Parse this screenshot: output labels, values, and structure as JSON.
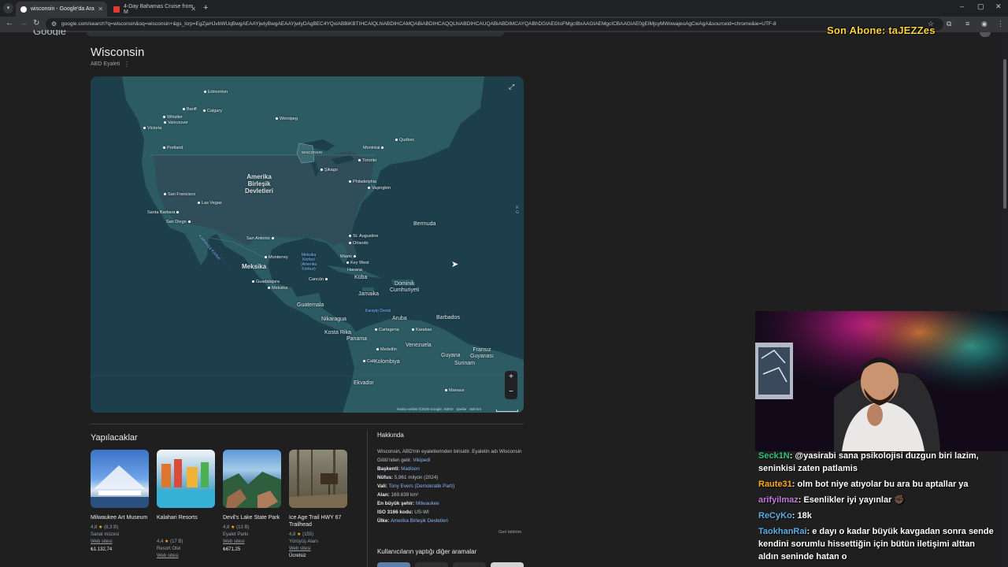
{
  "browser": {
    "tabs": [
      {
        "title": "wisconsin - Google'da Ara",
        "active": true
      },
      {
        "title": "4-Day Bahamas Cruise from M",
        "active": false
      }
    ],
    "url": "google.com/search?q=wisconsin&oq=wisconsin+&gs_lcrp=EgZjaHJvbWUqBwgAEAAYjwIyBwgAEAAYjwIyDAgBEC4YQxiABBiKBTIHCAIQLhiABDIHCAMQABiABDIHCAQQLhiABDIHCAUQABiABDIMCAYQABhDGIAEGIoFMgcIBxAAGIAEMgcICBAAGIAE0gEIMjcyMWowajeoAgCwAgA&sourceid=chrome&ie=UTF-8",
    "icons": {
      "back": "arrow-left-icon",
      "forward": "arrow-right-icon",
      "reload": "reload-icon",
      "bookmark": "star-icon",
      "extensions": "puzzle-icon",
      "profile": "profile-icon",
      "menu": "kebab-menu-icon"
    }
  },
  "overlay": {
    "subscriber": "Son Abone: taJEZZes"
  },
  "entity": {
    "title": "Wisconsin",
    "subtitle": "ABD Eyaleti",
    "more_glyph": "⋮"
  },
  "map": {
    "labels": {
      "edmonton": "Edmonton",
      "banff": "Banff",
      "calgary": "Calgary",
      "whistler": "Whistler",
      "vancouver": "Vancouver",
      "victoria": "Victoria",
      "winnipeg": "Winnipeg",
      "portland": "Portland",
      "wisconsin": "WISCONSIN",
      "quebec": "Québec",
      "montreal": "Montréal",
      "toronto": "Toronto",
      "chicago": "Şikago",
      "usa": "Amerika\nBirleşik\nDevletleri",
      "philadelphia": "Philadelphia",
      "washington": "Vaşington",
      "san_francisco": "San Francisco",
      "las_vegas": "Las Vegas",
      "santa_barbara": "Santa Barbara",
      "san_diego": "San Diego",
      "bermuda": "Bermuda",
      "california_gulf": "Kaliforniya Körfezi",
      "san_antonio": "San Antonio",
      "st_augustine": "St. Augustine",
      "orlando": "Orlando",
      "monterrey": "Monterrey",
      "mexico": "Meksika",
      "mexico_gulf": "Meksika\nKörfezi\n(Amerika\nKörfezi)",
      "miami": "Miami",
      "key_west": "Key West",
      "havana": "Havana",
      "cancun": "Cancún",
      "cuba": "Küba",
      "dominican": "Dominik\nCumhuriyeti",
      "guadalajara": "Guadalajara",
      "mexico_city": "Meksika",
      "jamaica": "Jamaika",
      "caribbean": "Karayip Denizi",
      "guatemala": "Guatemala",
      "barbados": "Barbados",
      "aruba": "Aruba",
      "nicaragua": "Nikaragua",
      "cartagena": "Cartagena",
      "caracas": "Karakas",
      "costa_rica": "Kosta Rika",
      "panama": "Panama",
      "venezuela": "Venezuela",
      "medellin": "Medellín",
      "guyana": "Guyana",
      "suriname": "Surinam",
      "french_guiana": "Fransız\nGuyanası",
      "cali": "Cali",
      "colombia": "Kolombiya",
      "ecuador": "Ekvador",
      "manaus": "Manaus",
      "edge": "K\nG"
    },
    "attribution": "Harita verileri ©2025 Google, INEGI",
    "terms": "Şartlar",
    "scale": "500 km",
    "zoom_in": "+",
    "zoom_out": "−",
    "expand_glyph": "⤢",
    "colors": {
      "ocean": "#1d3f4c",
      "land": "#2c5b63",
      "usa_land": "#2f4e59",
      "border": "#587d86"
    }
  },
  "things_to_do": {
    "title": "Yapılacaklar",
    "cards": [
      {
        "name": "Milwaukee Art Museum",
        "rating": "4,8",
        "reviews": "(8,3 B)",
        "type": "Sanat müzesi",
        "web": "Web sitesi",
        "price": "₺1.132,74"
      },
      {
        "name": "Kalahari Resorts",
        "rating": "4,4",
        "reviews": "(17 B)",
        "type": "Resort Otel",
        "web": "Web sitesi",
        "price": ""
      },
      {
        "name": "Devil's Lake State Park",
        "rating": "4,8",
        "reviews": "(13 B)",
        "type": "Eyalet Parkı",
        "web": "Web sitesi",
        "price": "₺671,25"
      },
      {
        "name": "Ice Age Trail HWY 67 Trailhead",
        "rating": "4,8",
        "reviews": "(155)",
        "type": "Yürüyüş Alanı",
        "web": "Web sitesi",
        "price": "Ücretsiz"
      }
    ]
  },
  "about": {
    "title": "Hakkında",
    "description": "Wisconsin, ABD'nin eyaletlerinden birisidir. Eyaletin adı Wisconsin Gölü'nden gelir.",
    "wiki_link": "Vikipedi",
    "facts": [
      {
        "label": "Başkenti:",
        "value": "Madison",
        "link": true
      },
      {
        "label": "Nüfus:",
        "value": "5,961 milyon (2024)",
        "link": false
      },
      {
        "label": "Vali:",
        "value": "Tony Evers (Demokratik Parti)",
        "link": true
      },
      {
        "label": "Alan:",
        "value": "169.639 km²",
        "link": false
      },
      {
        "label": "En büyük şehir:",
        "value": "Milwaukee",
        "link": true
      },
      {
        "label": "ISO 3166 kodu:",
        "value": "US-WI",
        "link": false
      },
      {
        "label": "Ülke:",
        "value": "Amerika Birleşik Devletleri",
        "link": true
      }
    ],
    "feedback": "Geri bildirim",
    "also_searched": "Kullanıcıların yaptığı diğer aramalar"
  },
  "chat": {
    "messages": [
      {
        "user": "Seck1N",
        "color": "#2ec27e",
        "text": ": @yasirabi sana psikolojisi duzgun biri lazim, seninkisi zaten patlamis"
      },
      {
        "user": "Raute31",
        "color": "#ffa726",
        "text": ": olm bot niye atıyolar bu ara bu aptallar ya"
      },
      {
        "user": "arifyilmaz",
        "color": "#c678dd",
        "text": ": Esenlikler iyi yayınlar ✊🏿"
      },
      {
        "user": "ReCyKo",
        "color": "#5dade2",
        "text": ": 18k"
      },
      {
        "user": "TaokhanRai",
        "color": "#5dade2",
        "text": ": e dayı o kadar büyük kavgadan sonra sende kendini sorumlu hissettiğin için bütün iletişimi alttan aldın seninde hatan o"
      }
    ]
  }
}
